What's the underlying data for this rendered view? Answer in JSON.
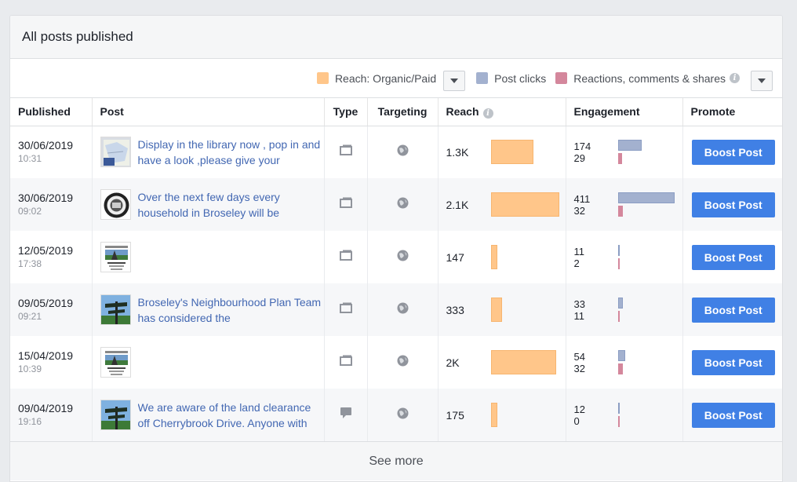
{
  "panel": {
    "title": "All posts published",
    "see_more": "See more"
  },
  "legend": {
    "reach_label": "Reach: Organic/Paid",
    "clicks_label": "Post clicks",
    "reactions_label": "Reactions, comments & shares",
    "colors": {
      "reach": "#ffc68a",
      "clicks": "#a3b1cf",
      "reactions": "#d4879c"
    }
  },
  "columns": {
    "published": "Published",
    "post": "Post",
    "type": "Type",
    "targeting": "Targeting",
    "reach": "Reach",
    "engagement": "Engagement",
    "promote": "Promote"
  },
  "boost_label": "Boost Post",
  "rows": [
    {
      "date": "30/06/2019",
      "time": "10:31",
      "post_text": "Display in the library now , pop in and have a look ,please give your",
      "thumb": "map",
      "type": "photo",
      "reach": "1.3K",
      "reach_frac": 0.62,
      "clicks": "174",
      "reactions": "29",
      "clicks_frac": 0.42,
      "reactions_frac": 0.07
    },
    {
      "date": "30/06/2019",
      "time": "09:02",
      "post_text": "Over the next few days every household in Broseley will be",
      "thumb": "seal",
      "type": "photo",
      "reach": "2.1K",
      "reach_frac": 1.0,
      "clicks": "411",
      "reactions": "32",
      "clicks_frac": 1.0,
      "reactions_frac": 0.08
    },
    {
      "date": "12/05/2019",
      "time": "17:38",
      "post_text": "",
      "thumb": "poster",
      "type": "photo",
      "reach": "147",
      "reach_frac": 0.07,
      "clicks": "11",
      "reactions": "2",
      "clicks_frac": 0.03,
      "reactions_frac": 0.01
    },
    {
      "date": "09/05/2019",
      "time": "09:21",
      "post_text": "Broseley's Neighbourhood Plan Team has considered the",
      "thumb": "sign",
      "type": "photo",
      "reach": "333",
      "reach_frac": 0.16,
      "clicks": "33",
      "reactions": "11",
      "clicks_frac": 0.08,
      "reactions_frac": 0.03
    },
    {
      "date": "15/04/2019",
      "time": "10:39",
      "post_text": "",
      "thumb": "poster",
      "type": "photo",
      "reach": "2K",
      "reach_frac": 0.95,
      "clicks": "54",
      "reactions": "32",
      "clicks_frac": 0.13,
      "reactions_frac": 0.08
    },
    {
      "date": "09/04/2019",
      "time": "19:16",
      "post_text": "We are aware of the land clearance off Cherrybrook Drive. Anyone with",
      "thumb": "sign",
      "type": "status",
      "reach": "175",
      "reach_frac": 0.08,
      "clicks": "12",
      "reactions": "0",
      "clicks_frac": 0.03,
      "reactions_frac": 0.01
    }
  ]
}
